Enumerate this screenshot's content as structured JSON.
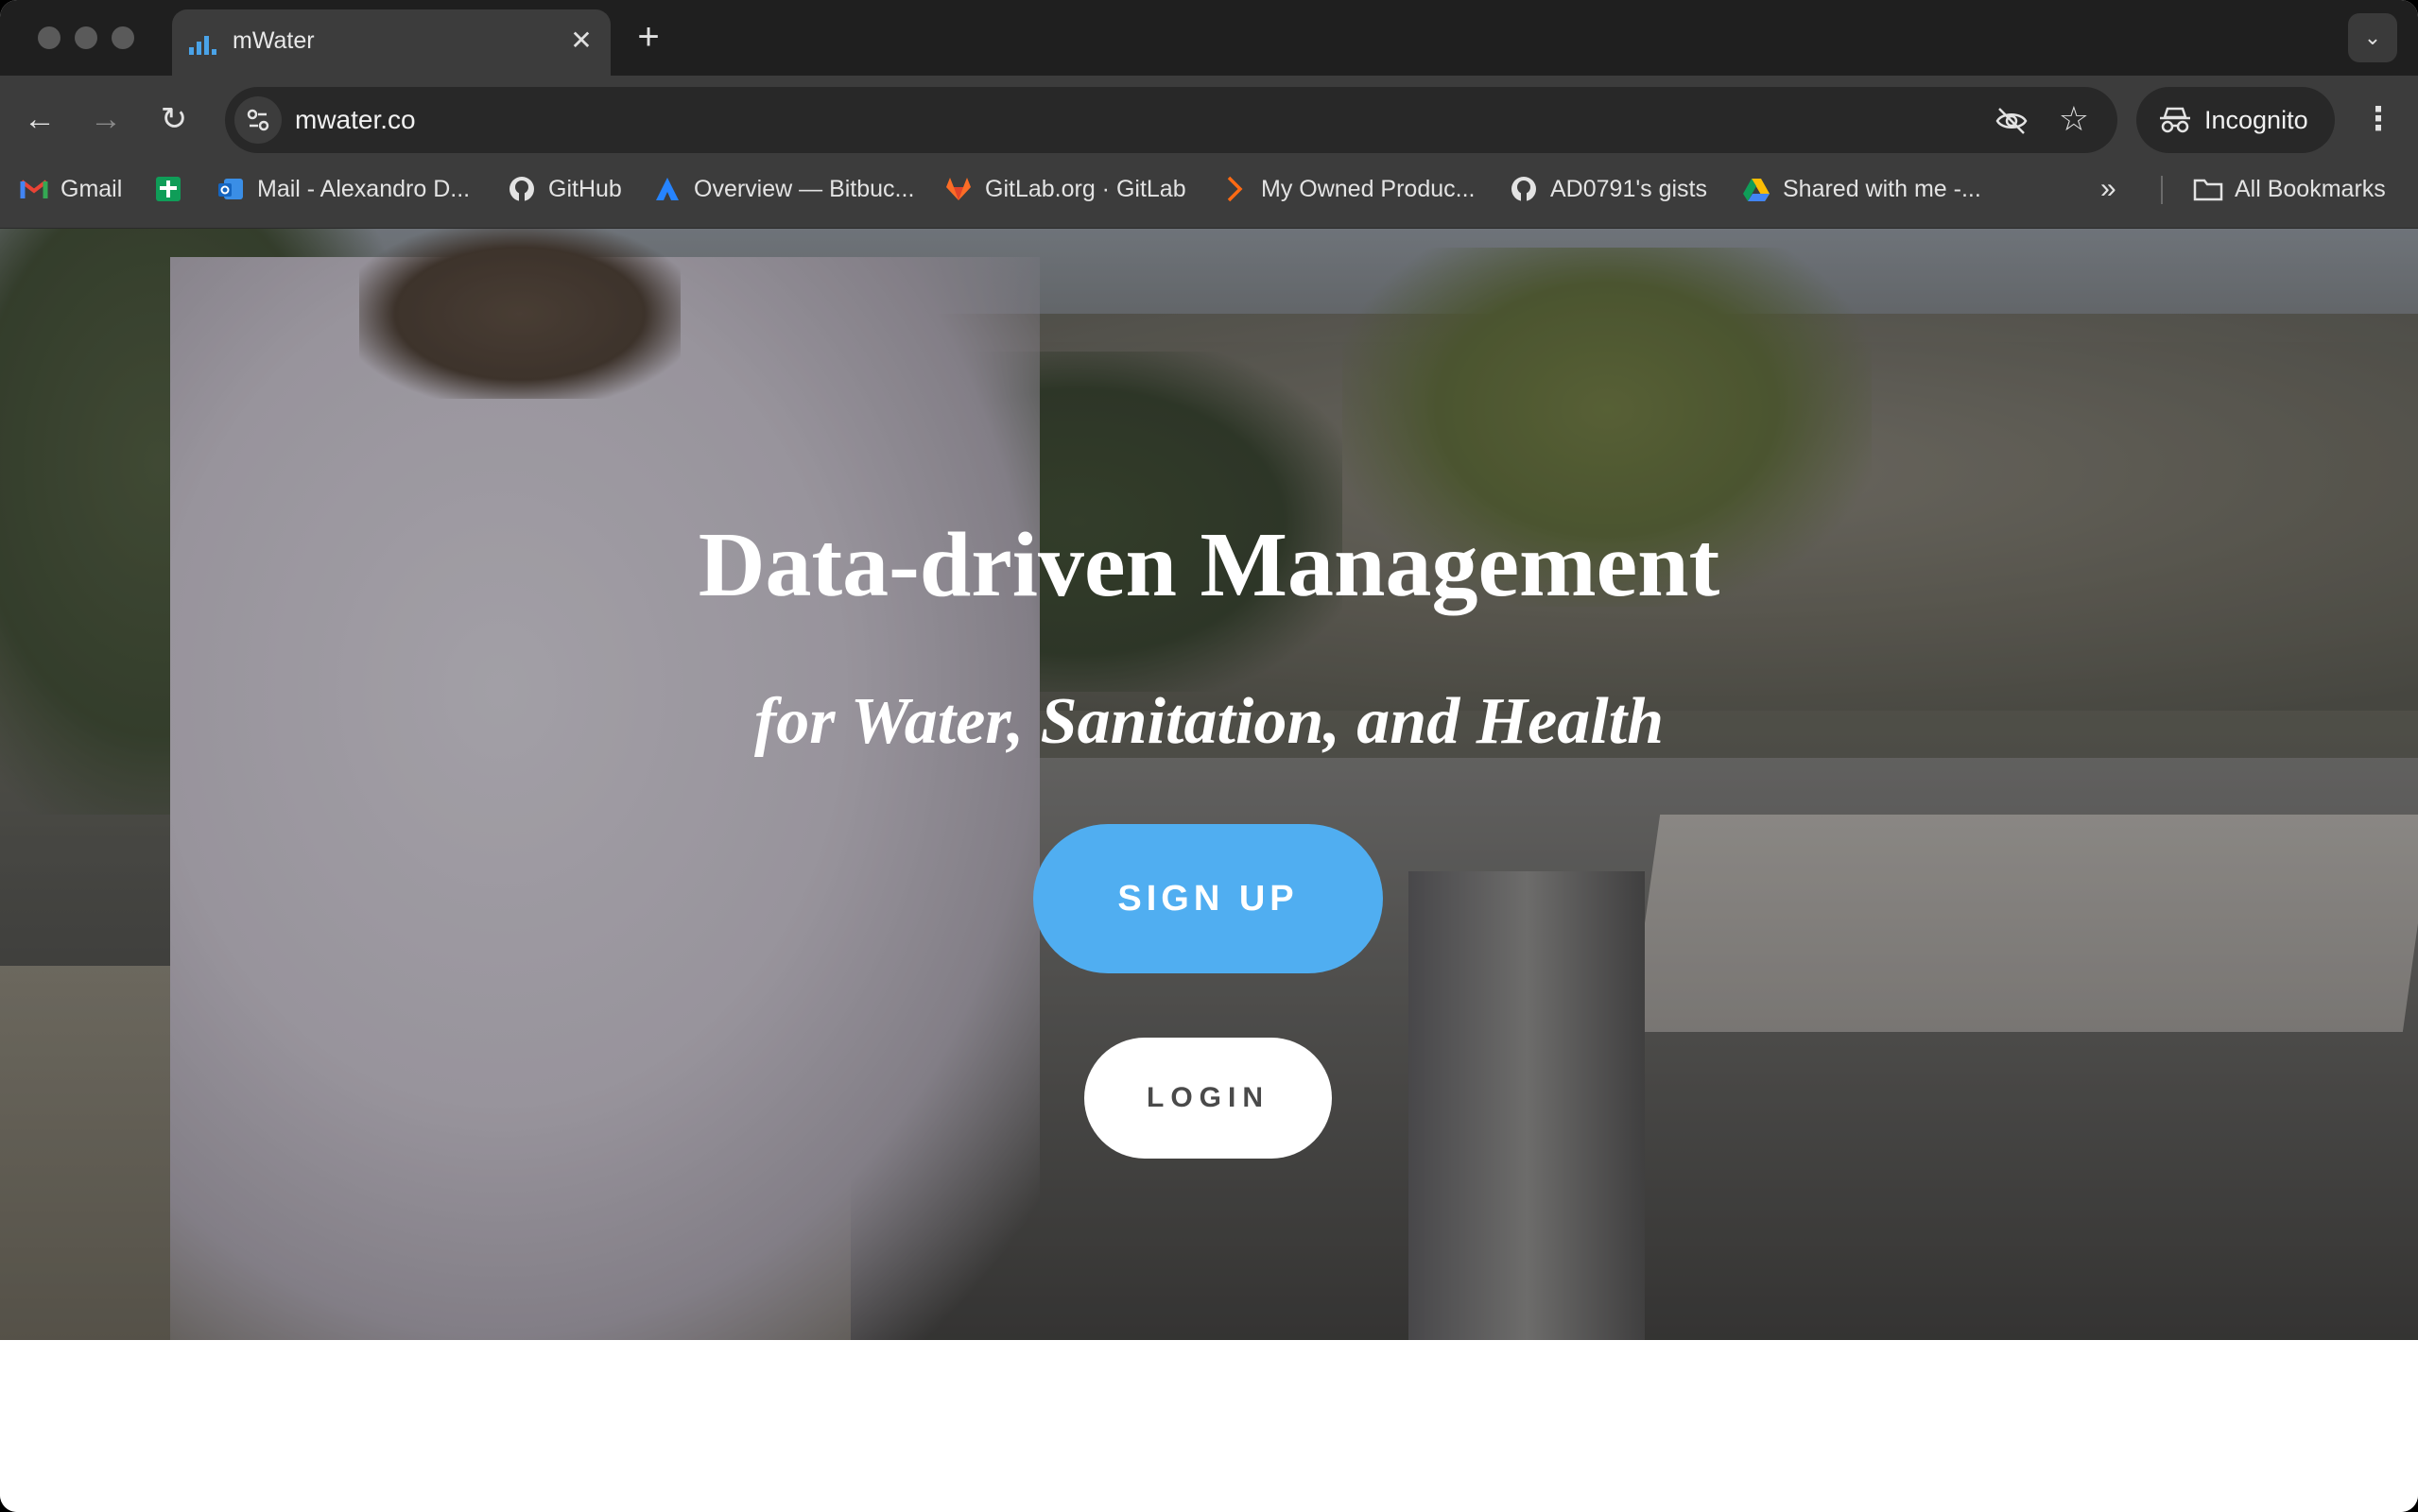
{
  "browser": {
    "tab": {
      "title": "mWater",
      "close_symbol": "✕"
    },
    "new_tab_symbol": "+",
    "tab_search_symbol": "⌄",
    "url": "mwater.co",
    "profile_label": "Incognito",
    "menu_symbol": "⋮",
    "nav": {
      "back_symbol": "←",
      "forward_symbol": "→",
      "reload_symbol": "↻"
    },
    "star_symbol": "☆",
    "icons": [
      "chart-favicon-icon",
      "site-info-icon",
      "eye-off-icon",
      "star-icon",
      "incognito-icon",
      "folder-icon"
    ]
  },
  "bookmarks": {
    "items": [
      {
        "label": "Gmail",
        "icon": "gmail-icon"
      },
      {
        "label": "",
        "icon": "google-sheets-icon"
      },
      {
        "label": "Mail - Alexandro D...",
        "icon": "outlook-icon"
      },
      {
        "label": "GitHub",
        "icon": "github-icon"
      },
      {
        "label": "Overview — Bitbuc...",
        "icon": "atlassian-icon"
      },
      {
        "label": "GitLab.org · GitLab",
        "icon": "gitlab-icon"
      },
      {
        "label": "My Owned Produc...",
        "icon": "product-icon"
      },
      {
        "label": "AD0791's gists",
        "icon": "github-icon"
      },
      {
        "label": "Shared with me -...",
        "icon": "google-drive-icon"
      }
    ],
    "overflow_symbol": "»",
    "all_bookmarks_label": "All Bookmarks"
  },
  "page": {
    "title": "Data-driven Management",
    "subtitle": "for Water, Sanitation, and Health",
    "signup_label": "SIGN UP",
    "login_label": "LOGIN"
  },
  "colors": {
    "signup_bg": "#50aef1",
    "login_bg": "#ffffff",
    "tabstrip_bg": "#1f1f1f",
    "toolbar_bg": "#3c3c3c"
  }
}
